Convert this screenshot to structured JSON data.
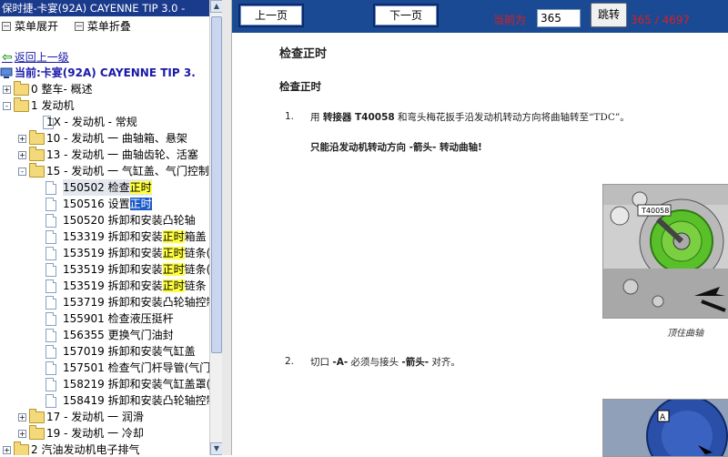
{
  "left_panel": {
    "title": "保时捷-卡宴(92A) CAYENNE TIP 3.0 -",
    "menu": {
      "expand": "菜单展开",
      "collapse": "菜单折叠"
    },
    "back": "返回上一级",
    "current": "当前:卡宴(92A) CAYENNE TIP 3.",
    "tree": [
      {
        "level": 0,
        "type": "folder",
        "expander": "+",
        "label": "0 整车- 概述"
      },
      {
        "level": 0,
        "type": "folder",
        "expander": "-",
        "label": "1 发动机"
      },
      {
        "level": 1,
        "type": "doc",
        "label": "1X - 发动机 - 常规"
      },
      {
        "level": 1,
        "type": "folder",
        "expander": "+",
        "label": "10 - 发动机 一 曲轴箱、悬架"
      },
      {
        "level": 1,
        "type": "folder",
        "expander": "+",
        "label": "13 - 发动机 一 曲轴齿轮、活塞"
      },
      {
        "level": 1,
        "type": "folder",
        "expander": "-",
        "label": "15 - 发动机 一 气缸盖、气门控制"
      },
      {
        "level": 2,
        "type": "doc",
        "state": "current",
        "pre": "150502 检查",
        "hl": "正时",
        "post": ""
      },
      {
        "level": 2,
        "type": "doc",
        "state": "selected",
        "pre": "150516 设置",
        "hl": "正时",
        "post": ""
      },
      {
        "level": 2,
        "type": "doc",
        "pre": "150520 拆卸和安装凸轮轴",
        "hl": "",
        "post": ""
      },
      {
        "level": 2,
        "type": "doc",
        "pre": "153319 拆卸和安装",
        "hl": "正时",
        "post": "箱盖"
      },
      {
        "level": 2,
        "type": "doc",
        "pre": "153519 拆卸和安装",
        "hl": "正时",
        "post": "链条("
      },
      {
        "level": 2,
        "type": "doc",
        "pre": "153519 拆卸和安装",
        "hl": "正时",
        "post": "链条("
      },
      {
        "level": 2,
        "type": "doc",
        "pre": "153519 拆卸和安装",
        "hl": "正时",
        "post": "链条"
      },
      {
        "level": 2,
        "type": "doc",
        "pre": "153719 拆卸和安装凸轮轴控制",
        "hl": "",
        "post": ""
      },
      {
        "level": 2,
        "type": "doc",
        "pre": "155901 检查液压挺杆",
        "hl": "",
        "post": ""
      },
      {
        "level": 2,
        "type": "doc",
        "pre": "156355 更换气门油封",
        "hl": "",
        "post": ""
      },
      {
        "level": 2,
        "type": "doc",
        "pre": "157019 拆卸和安装气缸盖",
        "hl": "",
        "post": ""
      },
      {
        "level": 2,
        "type": "doc",
        "pre": "157501 检查气门杆导管(气门",
        "hl": "",
        "post": ""
      },
      {
        "level": 2,
        "type": "doc",
        "pre": "158219 拆卸和安装气缸盖罩(",
        "hl": "",
        "post": ""
      },
      {
        "level": 2,
        "type": "doc",
        "pre": "158419 拆卸和安装凸轮轴控制",
        "hl": "",
        "post": ""
      },
      {
        "level": 1,
        "type": "folder",
        "expander": "+",
        "label": "17 - 发动机 一 润滑"
      },
      {
        "level": 1,
        "type": "folder",
        "expander": "+",
        "label": "19 - 发动机 一 冷却"
      },
      {
        "level": 0,
        "type": "folder",
        "expander": "+",
        "label": "2 汽油发动机电子排气"
      }
    ]
  },
  "toolbar": {
    "prev": "上一页",
    "next": "下一页",
    "current_label": "当前为",
    "page_value": "365",
    "jump": "跳转",
    "page_count": "365 / 4697"
  },
  "document": {
    "heading": "检查正时",
    "subheading": "检查正时",
    "step1": {
      "num": "1.",
      "a": "用 ",
      "b": "转接器 T40058",
      "c": " 和弯头梅花扳手沿发动机转动方向将曲轴转至“TDC”。",
      "note": "只能沿发动机转动方向 -箭头- 转动曲轴!"
    },
    "figure1": {
      "tool_label": "T40058",
      "caption": "顶住曲轴"
    },
    "step2": {
      "num": "2.",
      "a": "切口 ",
      "b": "-A-",
      "c": " 必须与接头 ",
      "d": "-箭头-",
      "e": " 对齐。"
    },
    "figure2": {
      "label": "A"
    }
  },
  "colors": {
    "title_bar": "#1a3a8c",
    "toolbar": "#1a4a94",
    "highlight": "#ffff40",
    "selection": "#1a5ac8",
    "page_text": "#d82020"
  }
}
